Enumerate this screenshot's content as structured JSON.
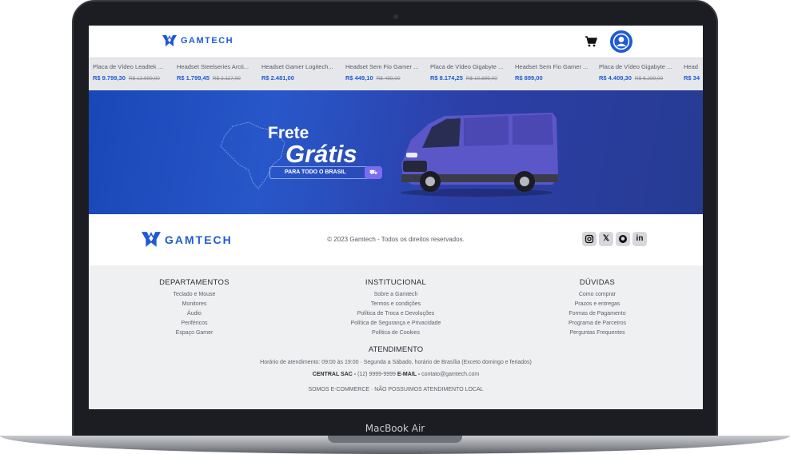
{
  "device": {
    "model_label": "MacBook Air"
  },
  "header": {
    "brand": "GAMTECH"
  },
  "ticker": [
    {
      "name": "Placa de Vídeo Leadtek ...",
      "price": "R$ 9.799,30",
      "old_price": "R$ 13.999,00"
    },
    {
      "name": "Headset Steelseries Arcti...",
      "price": "R$ 1.799,45",
      "old_price": "R$ 2.117,00"
    },
    {
      "name": "Headset Gamer Logitech...",
      "price": "R$ 2.481,00",
      "old_price": ""
    },
    {
      "name": "Headset Sem Fio Gamer ...",
      "price": "R$ 449,10",
      "old_price": "R$ 499,00"
    },
    {
      "name": "Placa de Vídeo Gigabyte ...",
      "price": "R$ 8.174,25",
      "old_price": "R$ 10.899,00"
    },
    {
      "name": "Headset Sem Fio Gamer ...",
      "price": "R$ 899,00",
      "old_price": ""
    },
    {
      "name": "Placa de Vídeo Gigabyte ...",
      "price": "R$ 4.409,30",
      "old_price": "R$ 6.299,00"
    },
    {
      "name": "Head",
      "price": "R$ 34",
      "old_price": ""
    }
  ],
  "banner": {
    "title_line1": "Frete",
    "title_line2": "Grátis",
    "subtitle": "PARA TODO O BRASIL"
  },
  "footer": {
    "brand": "GAMTECH",
    "copyright": "© 2023 Gamtech - Todos os direitos reservados.",
    "socials": [
      "instagram",
      "x",
      "github",
      "linkedin"
    ],
    "columns": [
      {
        "title": "DEPARTAMENTOS",
        "links": [
          "Teclado e Mouse",
          "Monitores",
          "Áudio",
          "Periféricos",
          "Espaço Gamer"
        ]
      },
      {
        "title": "INSTITUCIONAL",
        "links": [
          "Sobre a Gamtech",
          "Termos e condições",
          "Política de Troca e Devoluções",
          "Política de Segurança e Privacidade",
          "Política de Cookies"
        ]
      },
      {
        "title": "DÚVIDAS",
        "links": [
          "Como comprar",
          "Prazos e entregas",
          "Formas de Pagamento",
          "Programa de Parceiros",
          "Perguntas Frequentes"
        ]
      }
    ],
    "atendimento": {
      "title": "ATENDIMENTO",
      "hours": "Horário de atendimento: 09:00 às 19:00 · Segunda a Sábado, horário de Brasília (Exceto domingo e feriados)",
      "sac_label": "CENTRAL SAC -",
      "sac_value": "(12) 9999-9999",
      "email_label": "E-MAIL -",
      "email_value": "contato@gamtech.com",
      "note": "SOMOS E-COMMERCE · NÃO POSSUIMOS ATENDIMENTO LOCAL"
    }
  },
  "colors": {
    "brand_blue": "#1f5bd6",
    "banner_purple": "#7b6cf0"
  }
}
